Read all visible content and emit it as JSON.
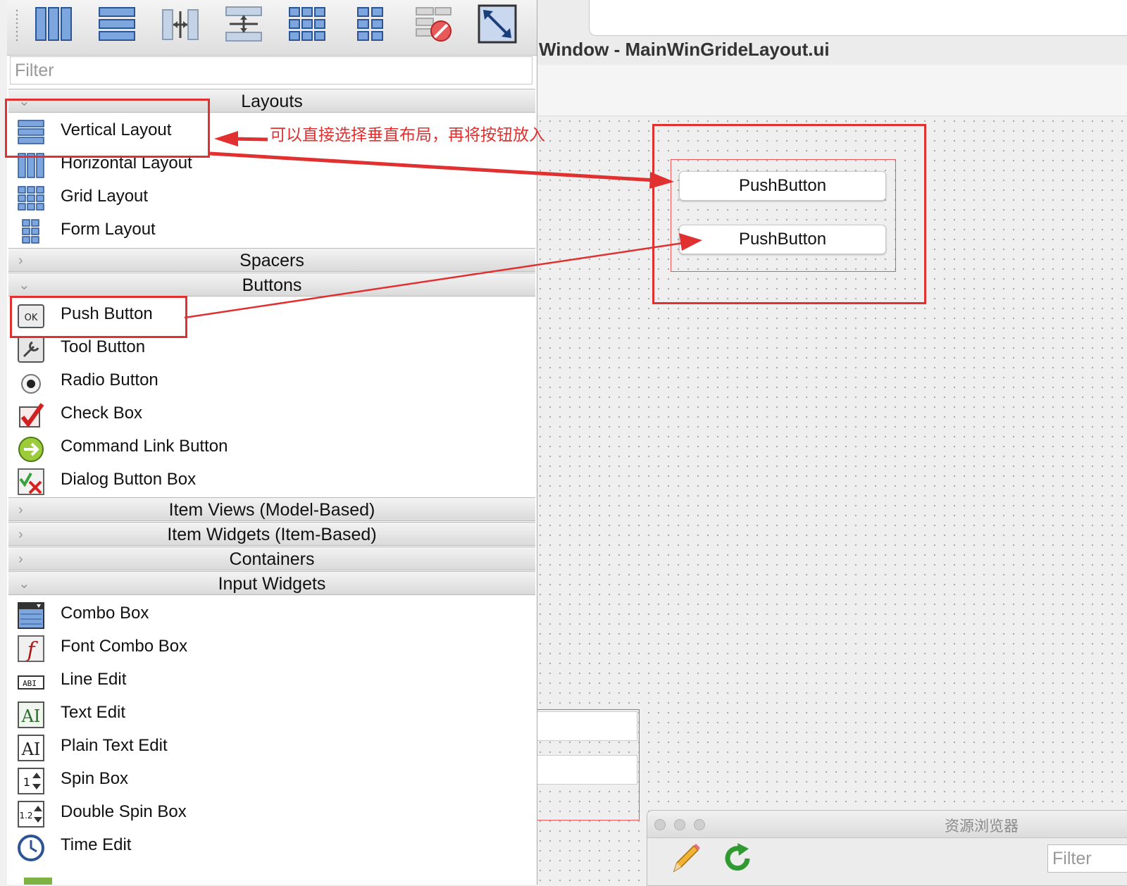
{
  "window_title": "Window - MainWinGrideLayout.ui",
  "filter": {
    "placeholder": "Filter"
  },
  "toolbar": {
    "icons": [
      "horizontal-layout-icon",
      "vertical-layout-icon",
      "horizontal-splitter-icon",
      "vertical-splitter-icon",
      "grid-layout-icon",
      "form-layout-icon",
      "break-layout-icon",
      "adjust-size-icon"
    ]
  },
  "categories": {
    "layouts": "Layouts",
    "spacers": "Spacers",
    "buttons": "Buttons",
    "item_views": "Item Views (Model-Based)",
    "item_widgets": "Item Widgets (Item-Based)",
    "containers": "Containers",
    "input_widgets": "Input Widgets"
  },
  "layouts_items": [
    "Vertical Layout",
    "Horizontal Layout",
    "Grid Layout",
    "Form Layout"
  ],
  "buttons_items": [
    "Push Button",
    "Tool Button",
    "Radio Button",
    "Check Box",
    "Command Link Button",
    "Dialog Button Box"
  ],
  "input_items": [
    "Combo Box",
    "Font Combo Box",
    "Line Edit",
    "Text Edit",
    "Plain Text Edit",
    "Spin Box",
    "Double Spin Box",
    "Time Edit"
  ],
  "annotation": "可以直接选择垂直布局，再将按钮放入",
  "form": {
    "push_button_1": "PushButton",
    "push_button_2": "PushButton"
  },
  "resource_browser": {
    "title": "资源浏览器",
    "filter_placeholder": "Filter"
  },
  "colors": {
    "annotation_red": "#e03030",
    "layout_border": "#ee5555"
  }
}
